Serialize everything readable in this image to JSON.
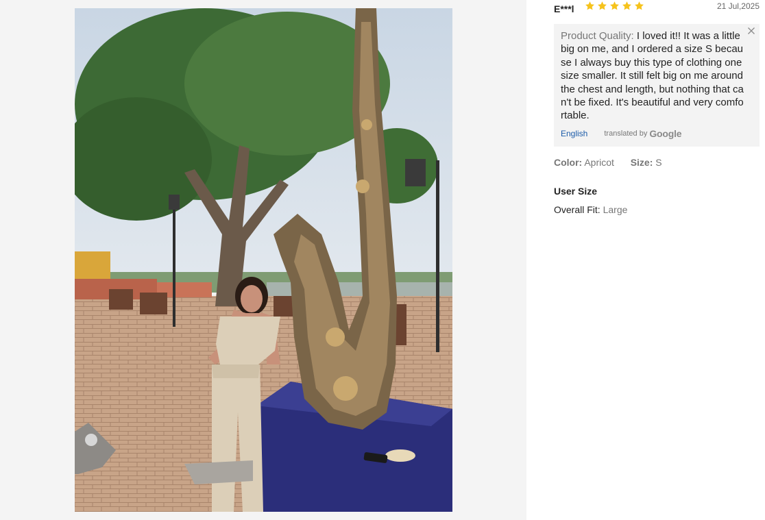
{
  "photo": {
    "alt": "customer-review-photo"
  },
  "review": {
    "reviewer": "E***l",
    "rating": 5,
    "date": "21 Jul,2025",
    "quality_label": "Product Quality:",
    "text": " I loved it!! It was a little big on me, and I ordered a size S because I always buy this type of clothing one size smaller. It still felt big on me around the chest and length, but nothing that can't be fixed. It's beautiful and very comfortable.",
    "language": "English",
    "translated_by": "translated by",
    "translator": "Google",
    "color_label": "Color:",
    "color_value": "Apricot",
    "size_label": "Size:",
    "size_value": "S",
    "user_size_title": "User Size",
    "fit_label": "Overall Fit:",
    "fit_value": "Large"
  },
  "colors": {
    "star": "#f6c31c",
    "link": "#1a5aa8",
    "box_bg": "#f3f3f3",
    "pane_bg": "#f4f4f4"
  }
}
